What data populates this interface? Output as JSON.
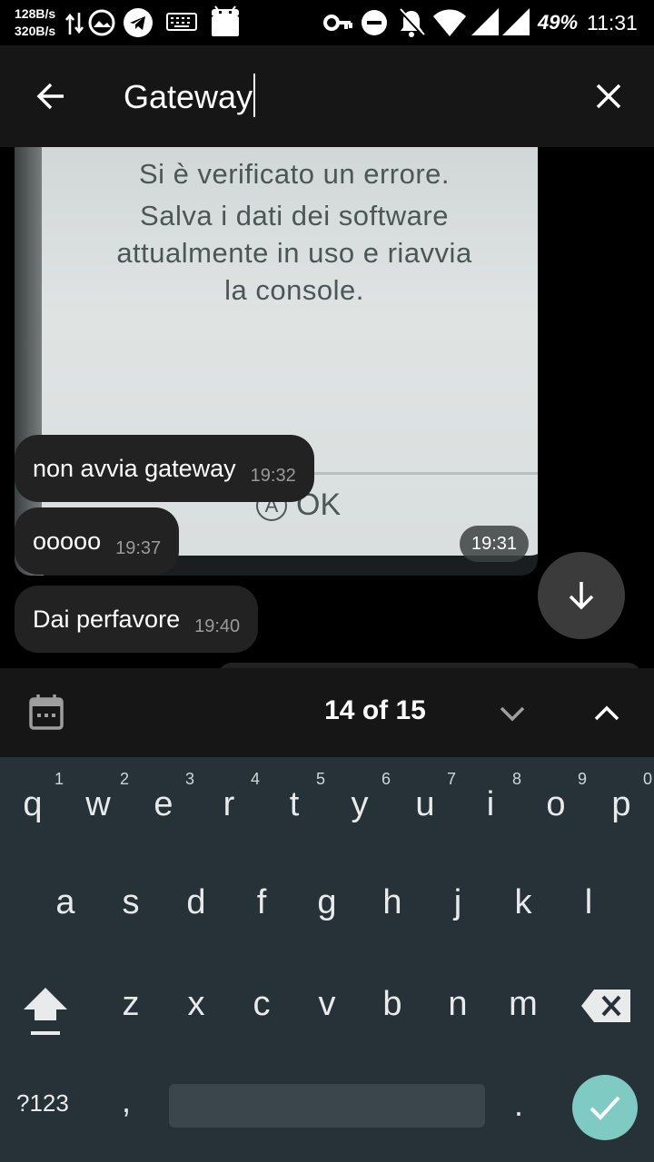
{
  "status_bar": {
    "net_up": "128B/s",
    "net_down": "320B/s",
    "battery": "49%",
    "time": "11:31",
    "icons": [
      "data-transfer-icon",
      "camera-app-icon",
      "telegram-icon",
      "keyboard-icon",
      "android-icon",
      "vpn-key-icon",
      "do-not-disturb-icon",
      "notifications-off-icon",
      "wifi-icon",
      "signal-icon",
      "signal-icon"
    ]
  },
  "toolbar": {
    "search_value": "Gateway"
  },
  "chat": {
    "photo": {
      "line1": "Si è verificato un errore.",
      "line2": "Salva i dati dei software",
      "line3": "attualmente in uso e riavvia",
      "line4": "la console.",
      "button_glyph": "A",
      "button_label": "OK",
      "time": "19:31"
    },
    "messages": [
      {
        "text": "non avvia gateway",
        "time": "19:32"
      },
      {
        "text": "ooooo",
        "time": "19:37"
      },
      {
        "text": "Dai perfavore",
        "time": "19:40"
      }
    ]
  },
  "search_results": {
    "count_label": "14 of 15"
  },
  "keyboard": {
    "row1": [
      {
        "letter": "q",
        "num": "1"
      },
      {
        "letter": "w",
        "num": "2"
      },
      {
        "letter": "e",
        "num": "3"
      },
      {
        "letter": "r",
        "num": "4"
      },
      {
        "letter": "t",
        "num": "5"
      },
      {
        "letter": "y",
        "num": "6"
      },
      {
        "letter": "u",
        "num": "7"
      },
      {
        "letter": "i",
        "num": "8"
      },
      {
        "letter": "o",
        "num": "9"
      },
      {
        "letter": "p",
        "num": "0"
      }
    ],
    "row2": [
      "a",
      "s",
      "d",
      "f",
      "g",
      "h",
      "j",
      "k",
      "l"
    ],
    "row3": [
      "z",
      "x",
      "c",
      "v",
      "b",
      "n",
      "m"
    ],
    "symbols_label": "?123",
    "comma": ",",
    "period": ".",
    "accent_color": "#7fcbc3"
  }
}
